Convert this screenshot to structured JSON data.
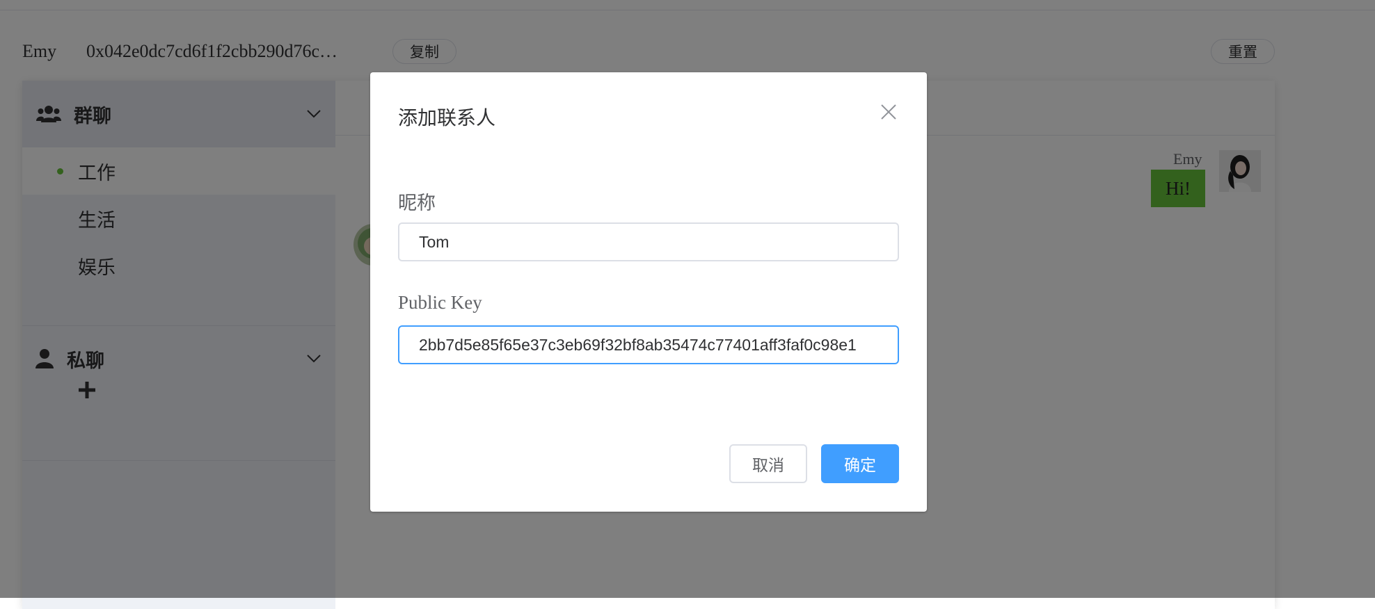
{
  "header": {
    "user_name": "Emy",
    "user_key": "0x042e0dc7cd6f1f2cbb290d76c…",
    "copy_label": "复制",
    "reset_label": "重置"
  },
  "sidebar": {
    "group_chat": {
      "title": "群聊",
      "items": [
        {
          "label": "工作",
          "active": true
        },
        {
          "label": "生活"
        },
        {
          "label": "娱乐"
        }
      ]
    },
    "private_chat": {
      "title": "私聊"
    }
  },
  "chat": {
    "messages": [
      {
        "sender": "Emy",
        "text": "Hi!"
      }
    ]
  },
  "dialog": {
    "title": "添加联系人",
    "nickname_label": "昵称",
    "nickname_value": "Tom",
    "public_key_label": "Public Key",
    "public_key_value": "2bb7d5e85f65e37c3eb69f32bf8ab35474c77401aff3faf0c98e1",
    "cancel_label": "取消",
    "confirm_label": "确定"
  },
  "colors": {
    "primary": "#409eff",
    "bubble": "#67c23a",
    "active_dot": "#67c23a"
  },
  "icons": {
    "group_chat": "users-icon",
    "private_chat": "user-icon",
    "expand": "chevron-down-icon",
    "add": "plus-icon",
    "close": "close-icon"
  }
}
